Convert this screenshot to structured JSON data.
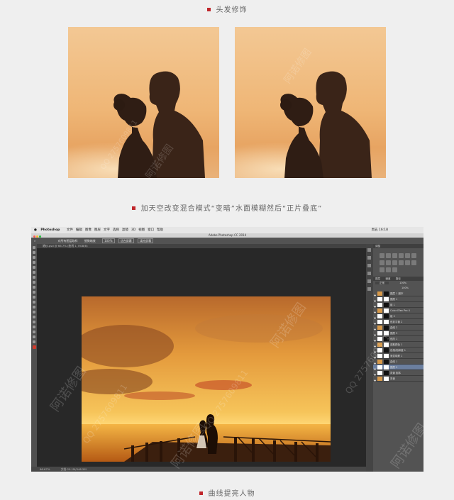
{
  "captions": {
    "top": "头发修饰",
    "middle": "加天空改变混合模式“变暗”水面模糊然后“正片叠底”",
    "bottom": "曲线提亮人物"
  },
  "photoshop": {
    "app_name": "Photoshop",
    "menu_items": [
      "文件",
      "编辑",
      "图像",
      "图层",
      "文字",
      "选择",
      "滤镜",
      "3D",
      "视图",
      "窗口",
      "帮助"
    ],
    "clock": "周五 16:18",
    "window_title": "Adobe Photoshop CC 2014",
    "options": {
      "sample_all_layers": "对所有图层取样",
      "sample_all_layers_2": "细微缩放",
      "zoom_100": "100%",
      "fit_screen": "适合屏幕",
      "fill_screen": "填充屏幕"
    },
    "doc_tab": "婚纱.psd @ 66.7% (曲线 1, RGB/8)",
    "status_zoom": "66.67%",
    "status_doc": "文档:20.1M/546.5M",
    "panel_headers": {
      "adjust": "调整",
      "layers": "图层",
      "channels": "通道",
      "paths": "路径"
    },
    "blend_mode": "正常",
    "opacity": "100%",
    "fill": "100%",
    "layers": [
      {
        "name": "图层 1 副本",
        "selected": false
      },
      {
        "name": "图层 1",
        "selected": false
      },
      {
        "name": "组 1",
        "selected": false
      },
      {
        "name": "Color Efex Pro 4",
        "selected": false
      },
      {
        "name": "组 2",
        "selected": false
      },
      {
        "name": "色彩平衡 2",
        "selected": false
      },
      {
        "name": "曲线 2",
        "selected": false
      },
      {
        "name": "图层 3",
        "selected": false
      },
      {
        "name": "色阶 1",
        "selected": false
      },
      {
        "name": "选取颜色 1",
        "selected": false
      },
      {
        "name": "色相/饱和度 1",
        "selected": false
      },
      {
        "name": "渐变映射 1",
        "selected": false
      },
      {
        "name": "曲线 1",
        "selected": false
      },
      {
        "name": "图层 2",
        "selected": true
      },
      {
        "name": "背景 副本",
        "selected": false
      },
      {
        "name": "背景",
        "selected": false
      }
    ]
  },
  "watermarks": {
    "cn": "阿诺修图",
    "qq": "QQ 2757609811"
  },
  "colors": {
    "bullet": "#c0262b",
    "sky_top": "#c97a35",
    "sky_mid": "#f2b04a",
    "sea": "#e8982c"
  }
}
